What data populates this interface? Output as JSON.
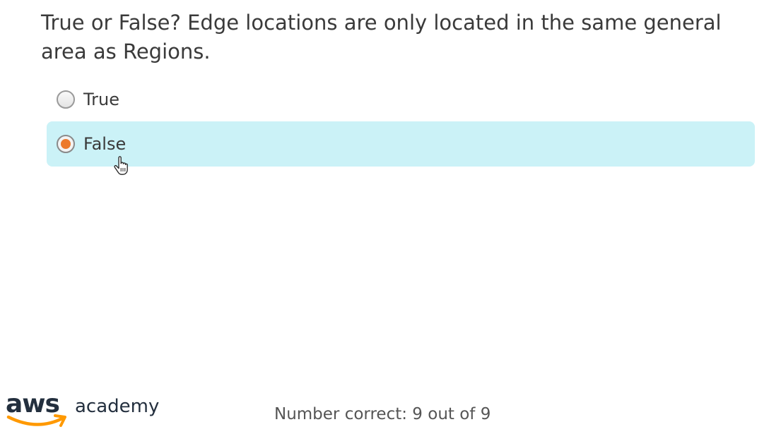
{
  "question": {
    "text": "True or False? Edge locations are only located in the same general area as Regions."
  },
  "options": [
    {
      "label": "True",
      "selected": false
    },
    {
      "label": "False",
      "selected": true
    }
  ],
  "footer": {
    "logo_aws": "aws",
    "logo_academy": "academy",
    "score_text": "Number correct: 9 out of 9"
  },
  "colors": {
    "selected_row": "#cbf2f7",
    "radio_dot": "#ec7a2c",
    "aws_smile": "#f90",
    "aws_text": "#232f3e"
  },
  "icons": {
    "cursor": "hand-pointer-icon",
    "radio": "radio-button-icon",
    "smile": "amazon-smile-icon"
  }
}
